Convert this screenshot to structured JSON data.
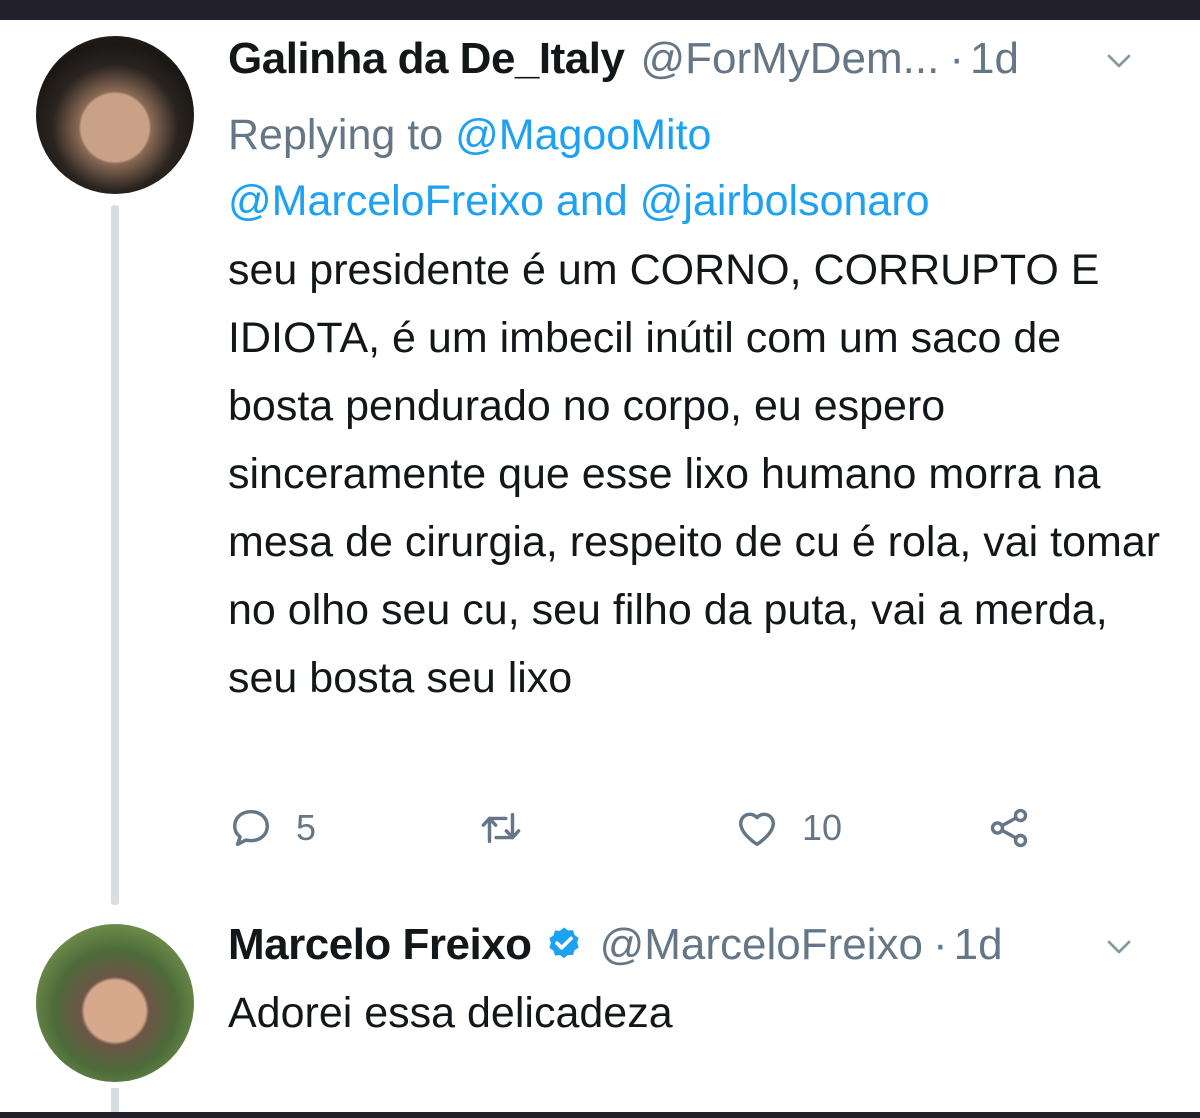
{
  "tweet1": {
    "display_name": "Galinha da De_Italy",
    "handle": "@ForMyDem...",
    "separator": "·",
    "time": "1d",
    "replying_prefix": "Replying to",
    "mention_1": "@MagooMito",
    "mention_2": "@MarceloFreixo",
    "and": "and",
    "mention_3": "@jairbolsonaro",
    "text": "seu presidente é um CORNO, CORRUPTO E IDIOTA, é um imbecil inútil com um saco de bosta pendurado no corpo, eu espero sinceramente que esse lixo humano morra na mesa de cirurgia, respeito de cu é rola, vai tomar no olho seu cu, seu filho da puta, vai a merda, seu bosta seu lixo",
    "reply_count": "5",
    "retweet_count": "",
    "like_count": "10"
  },
  "tweet2": {
    "display_name": "Marcelo Freixo",
    "handle": "@MarceloFreixo",
    "separator": "·",
    "time": "1d",
    "text": "Adorei essa delicadeza"
  },
  "icons": [
    "chevron-down-icon",
    "reply-icon",
    "retweet-icon",
    "like-icon",
    "share-icon",
    "verified-badge-icon"
  ],
  "colors": {
    "link": "#1da1f2",
    "muted": "#657786",
    "text": "#14171a",
    "thread_line": "#d8dde2"
  }
}
